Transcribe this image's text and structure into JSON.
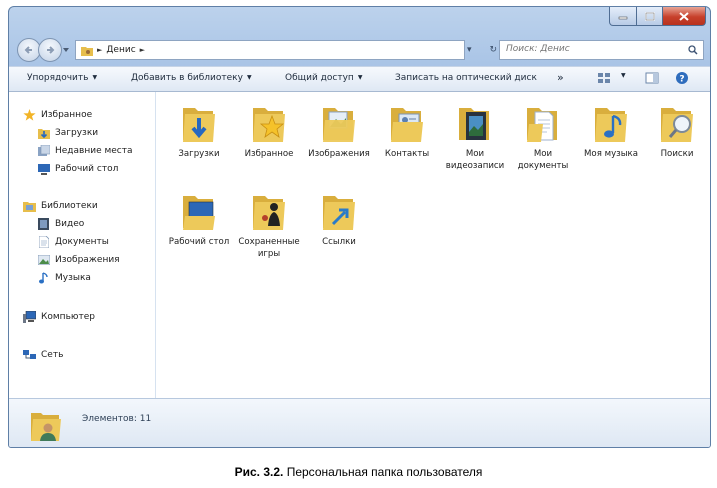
{
  "address": {
    "path": [
      "Денис"
    ],
    "search_placeholder": "Поиск: Денис"
  },
  "toolbar": {
    "organize": "Упорядочить",
    "add_to_library": "Добавить в библиотеку",
    "share": "Общий доступ",
    "burn": "Записать на оптический диск",
    "more": "»"
  },
  "sidebar": {
    "favorites": {
      "title": "Избранное",
      "items": [
        "Загрузки",
        "Недавние места",
        "Рабочий стол"
      ]
    },
    "libraries": {
      "title": "Библиотеки",
      "items": [
        "Видео",
        "Документы",
        "Изображения",
        "Музыка"
      ]
    },
    "computer": "Компьютер",
    "network": "Сеть"
  },
  "content": {
    "items": [
      {
        "label": "Загрузки",
        "icon": "downloads-folder-icon"
      },
      {
        "label": "Избранное",
        "icon": "favorites-folder-icon"
      },
      {
        "label": "Изображения",
        "icon": "pictures-folder-icon"
      },
      {
        "label": "Контакты",
        "icon": "contacts-folder-icon"
      },
      {
        "label": "Мои видеозаписи",
        "icon": "videos-folder-icon"
      },
      {
        "label": "Мои документы",
        "icon": "documents-folder-icon"
      },
      {
        "label": "Моя музыка",
        "icon": "music-folder-icon"
      },
      {
        "label": "Поиски",
        "icon": "searches-folder-icon"
      },
      {
        "label": "Рабочий стол",
        "icon": "desktop-folder-icon"
      },
      {
        "label": "Сохраненные игры",
        "icon": "saved-games-folder-icon"
      },
      {
        "label": "Ссылки",
        "icon": "links-folder-icon"
      }
    ]
  },
  "details": {
    "count_text": "Элементов: 11"
  },
  "caption": {
    "prefix": "Рис. 3.2.",
    "text": " Персональная папка пользователя"
  },
  "colors": {
    "folder": "#e9c250",
    "window_frame": "#a9c4e6",
    "close_button": "#c7402b"
  }
}
